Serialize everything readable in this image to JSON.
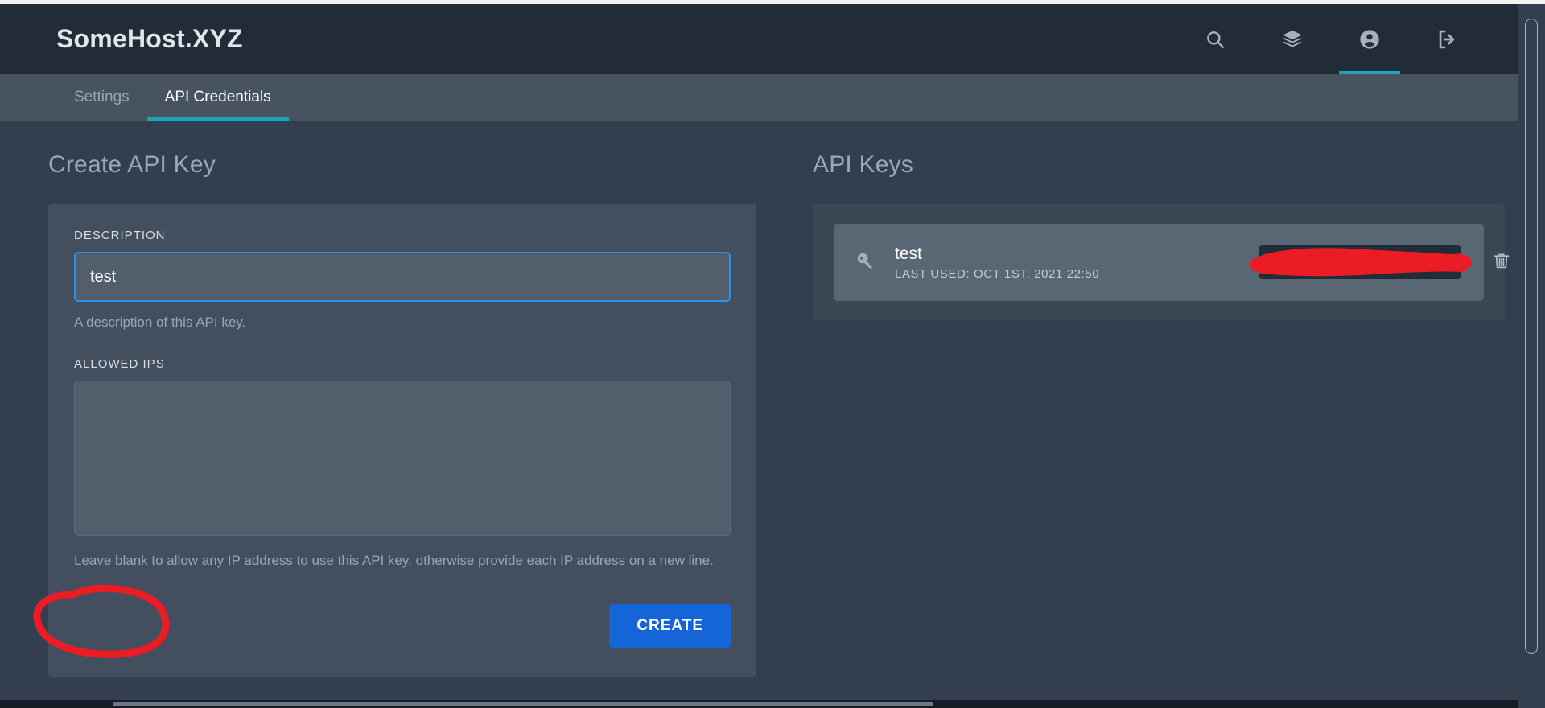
{
  "window": {
    "brand": "SomeHost.XYZ"
  },
  "header": {
    "icons": [
      {
        "name": "search-icon",
        "label": "Search"
      },
      {
        "name": "layers-icon",
        "label": "Services"
      },
      {
        "name": "account-icon",
        "label": "Account"
      },
      {
        "name": "logout-icon",
        "label": "Log out"
      }
    ],
    "active_icon": "account-icon"
  },
  "tabs": [
    {
      "label": "Settings",
      "active": false
    },
    {
      "label": "API Credentials",
      "active": true
    }
  ],
  "create_form": {
    "title": "Create API Key",
    "description_label": "DESCRIPTION",
    "description_value": "test",
    "description_placeholder": "",
    "description_help": "A description of this API key.",
    "allowed_ips_label": "ALLOWED IPS",
    "allowed_ips_value": "",
    "allowed_ips_placeholder": "",
    "allowed_ips_help": "Leave blank to allow any IP address to use this API key, otherwise provide each IP address on a new line.",
    "create_button": "CREATE"
  },
  "api_keys": {
    "title": "API Keys",
    "rows": [
      {
        "icon": "key-icon",
        "name": "test",
        "last_used": "LAST USED: OCT 1ST, 2021 22:50",
        "token": "",
        "token_redacted": true,
        "delete_icon": "trash-icon"
      }
    ]
  },
  "annotations": {
    "create_button_circle": "red-circle-highlight",
    "token_redaction": "red-scribble-redaction"
  },
  "colors": {
    "accent_teal": "#1aa6b7",
    "accent_blue": "#1565d8",
    "focus_blue": "#2a92f0",
    "annotation_red": "#ec1c24",
    "header_bg": "#222c38",
    "tabbar_bg": "#47535f",
    "page_bg": "#333f4e",
    "card_bg": "#434f5e",
    "row_bg": "#596673"
  }
}
